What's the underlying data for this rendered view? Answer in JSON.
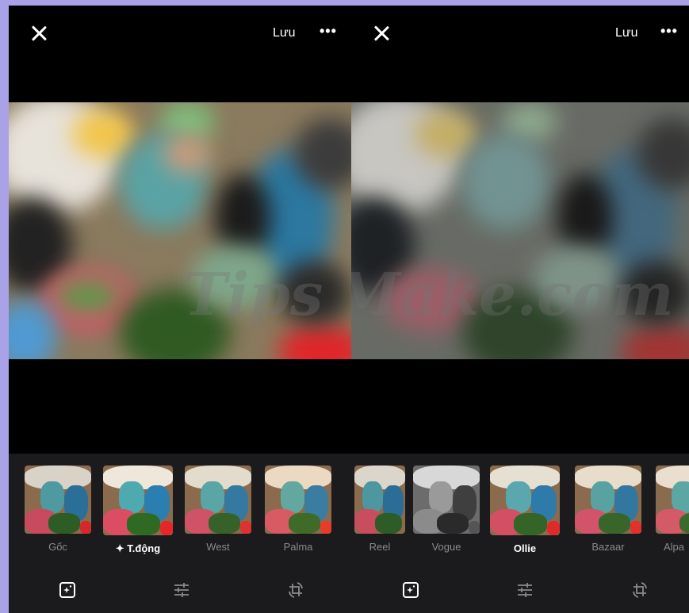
{
  "left_pane": {
    "save_label": "Lưu",
    "more_label": "•••",
    "filters": [
      {
        "label": "Gốc",
        "selected": false,
        "style": "normal"
      },
      {
        "label": "✦ T.động",
        "selected": true,
        "style": "vivid"
      },
      {
        "label": "West",
        "selected": false,
        "style": "normal"
      },
      {
        "label": "Palma",
        "selected": false,
        "style": "normal"
      }
    ],
    "tools": [
      "filter-tool-icon",
      "adjust-sliders-icon",
      "crop-rotate-icon"
    ]
  },
  "right_pane": {
    "save_label": "Lưu",
    "more_label": "•••",
    "filters": [
      {
        "label": "Reel",
        "selected": false,
        "style": "normal"
      },
      {
        "label": "Vogue",
        "selected": false,
        "style": "mono"
      },
      {
        "label": "Ollie",
        "selected": true,
        "style": "normal"
      },
      {
        "label": "Bazaar",
        "selected": false,
        "style": "normal"
      },
      {
        "label": "Alpa",
        "selected": false,
        "style": "normal"
      }
    ],
    "tools": [
      "filter-tool-icon",
      "adjust-sliders-icon",
      "crop-rotate-icon"
    ]
  },
  "watermark": "TipsMake.com",
  "colors": {
    "background": "#000000",
    "tray": "#1b1b1d",
    "label_inactive": "#8a8a8d",
    "label_active": "#ffffff",
    "border": "#a9a2e6"
  }
}
